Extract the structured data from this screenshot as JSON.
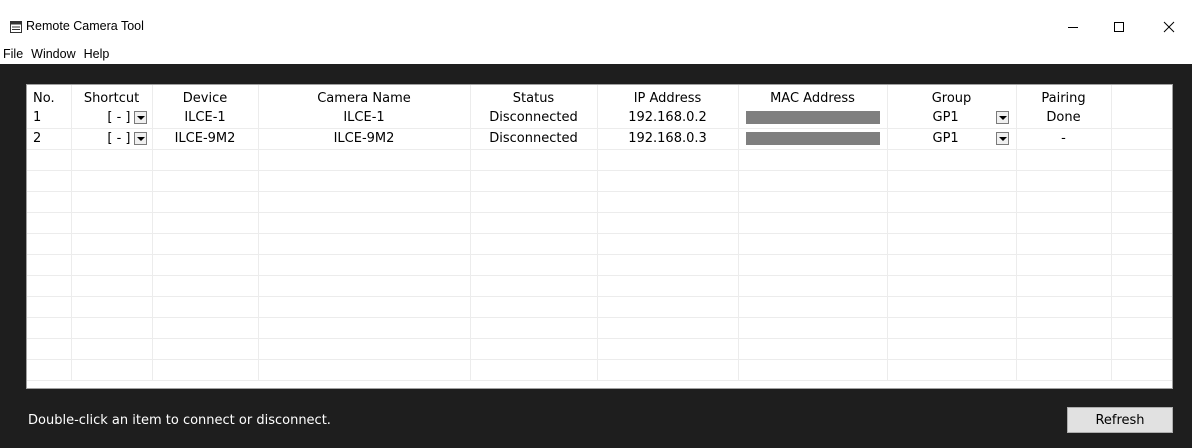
{
  "window": {
    "title": "Remote Camera Tool",
    "minimize_glyph": "—",
    "maximize_glyph": "☐",
    "close_glyph": "✕"
  },
  "menu": {
    "items": [
      "File",
      "Window",
      "Help"
    ]
  },
  "table": {
    "columns": [
      "No.",
      "Shortcut",
      "Device",
      "Camera Name",
      "Status",
      "IP Address",
      "MAC Address",
      "Group",
      "Pairing"
    ],
    "rows": [
      {
        "no": "1",
        "shortcut": "[ - ]",
        "device": "ILCE-1",
        "camera_name": "ILCE-1",
        "status": "Disconnected",
        "ip": "192.168.0.2",
        "mac_redacted": true,
        "group": "GP1",
        "pairing": "Done"
      },
      {
        "no": "2",
        "shortcut": "[ - ]",
        "device": "ILCE-9M2",
        "camera_name": "ILCE-9M2",
        "status": "Disconnected",
        "ip": "192.168.0.3",
        "mac_redacted": true,
        "group": "GP1",
        "pairing": "-"
      }
    ],
    "empty_rows": 11
  },
  "footer": {
    "hint": "Double-click an item to connect or disconnect.",
    "refresh_label": "Refresh"
  },
  "colors": {
    "client_bg": "#1e1e1e",
    "mac_redaction": "#7f7f7f",
    "button_bg": "#e1e1e1"
  }
}
